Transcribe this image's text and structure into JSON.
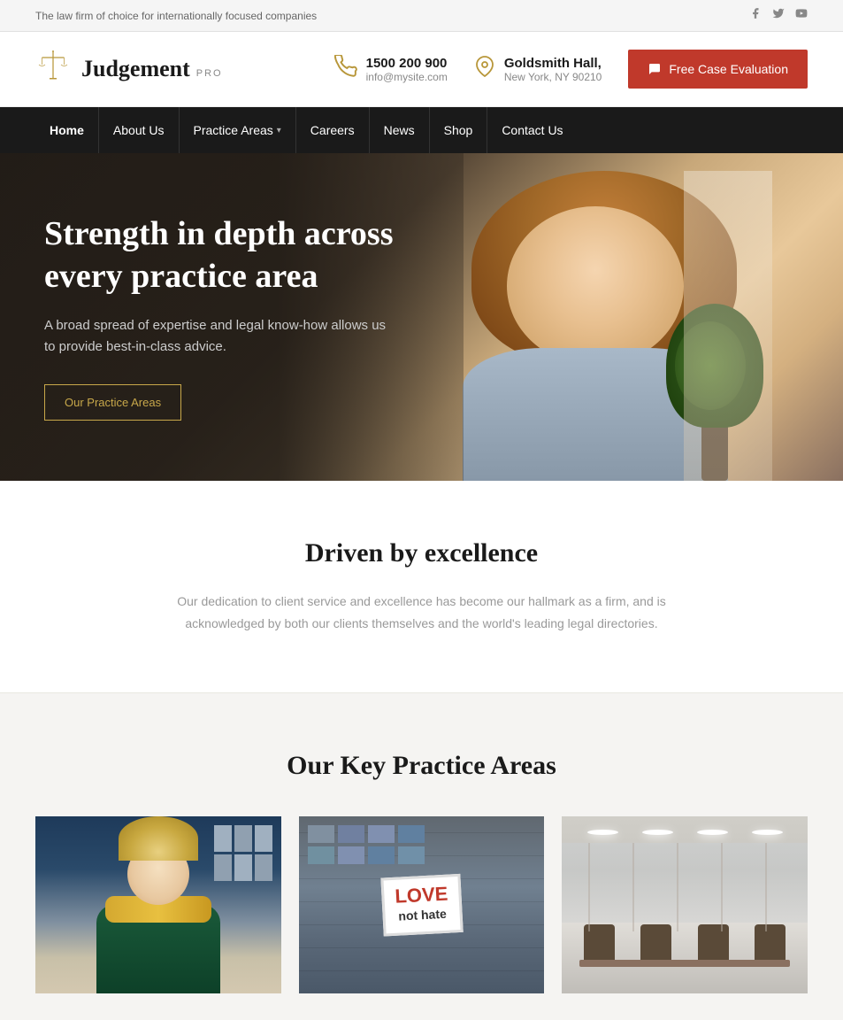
{
  "topbar": {
    "tagline": "The law firm of choice for internationally focused companies",
    "social": {
      "facebook": "f",
      "twitter": "t",
      "youtube": "▶"
    }
  },
  "header": {
    "logo": {
      "name": "Judgement",
      "suffix": "PRO"
    },
    "phone": {
      "number": "1500 200 900",
      "email": "info@mysite.com"
    },
    "address": {
      "line1": "Goldsmith Hall,",
      "line2": "New York, NY 90210"
    },
    "cta": "Free Case Evaluation"
  },
  "nav": {
    "items": [
      {
        "label": "Home",
        "active": true,
        "dropdown": false
      },
      {
        "label": "About Us",
        "active": false,
        "dropdown": false
      },
      {
        "label": "Practice Areas",
        "active": false,
        "dropdown": true
      },
      {
        "label": "Careers",
        "active": false,
        "dropdown": false
      },
      {
        "label": "News",
        "active": false,
        "dropdown": false
      },
      {
        "label": "Shop",
        "active": false,
        "dropdown": false
      },
      {
        "label": "Contact Us",
        "active": false,
        "dropdown": false
      }
    ]
  },
  "hero": {
    "title": "Strength in depth across every practice area",
    "subtitle": "A broad spread of expertise and legal know-how allows us to provide best-in-class advice.",
    "button": "Our Practice Areas"
  },
  "excellence": {
    "title": "Driven by excellence",
    "text": "Our dedication to client service and excellence has become our hallmark as a firm, and is acknowledged by both our clients themselves and the world's leading legal directories."
  },
  "practice": {
    "title": "Our Key Practice Areas",
    "cards": [
      {
        "id": "card-1",
        "type": "blonde-woman"
      },
      {
        "id": "card-2",
        "type": "love-not-hate"
      },
      {
        "id": "card-3",
        "type": "office"
      }
    ],
    "love_sign_line1": "LOVE",
    "love_sign_line2": "not hate"
  }
}
